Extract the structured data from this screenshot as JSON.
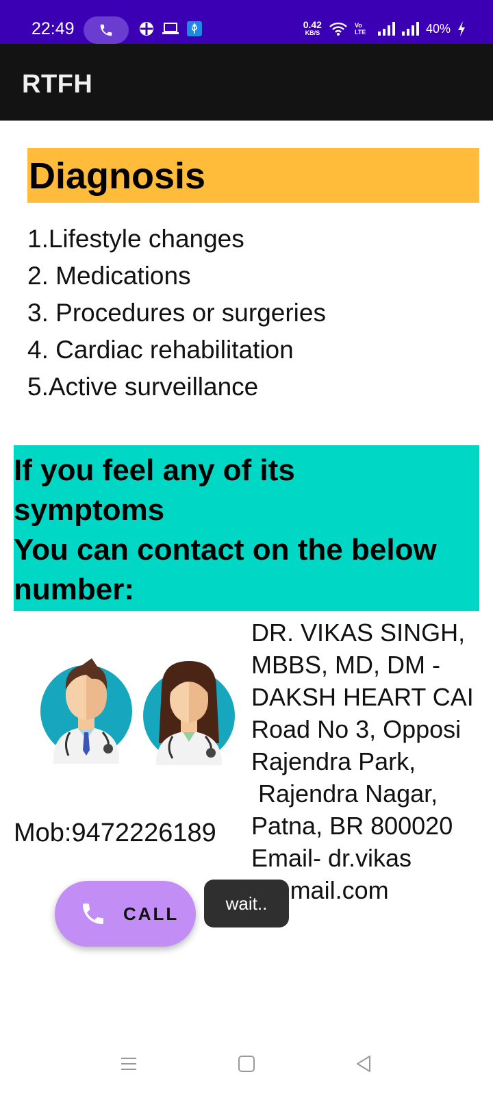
{
  "status_bar": {
    "time": "22:49",
    "net_speed_value": "0.42",
    "net_speed_unit": "KB/S",
    "volte": "Vo LTE",
    "battery": "40%",
    "colors": {
      "bar": "#3c00b4",
      "pill": "#6a3cd0"
    },
    "icons": [
      "phone-icon",
      "settings-grid-icon",
      "laptop-icon",
      "usb-icon",
      "wifi-icon",
      "signal-icon",
      "signal-icon",
      "charging-icon"
    ]
  },
  "app": {
    "title": "RTFH"
  },
  "diagnosis": {
    "heading": "Diagnosis",
    "items": [
      "1.Lifestyle changes",
      "2. Medications",
      "3. Procedures or surgeries",
      "4. Cardiac rehabilitation",
      "5.Active surveillance"
    ],
    "heading_color": "#ffbb3a"
  },
  "contact": {
    "line1": "If you feel any of its",
    "line2": "symptoms",
    "line3": "You can contact on the below",
    "line4": "number:",
    "color": "#00d7c4"
  },
  "doctor": {
    "mobile": "Mob:9472226189",
    "address_lines": [
      "DR. VIKAS SINGH,",
      "MBBS, MD, DM -",
      "DAKSH HEART CAI",
      "Road No 3, Opposi",
      "Rajendra Park,",
      " Rajendra Nagar,",
      "Patna, BR 800020",
      "Email- dr.vikas",
      "@gmail.com"
    ],
    "illustration": "doctors-illustration"
  },
  "call_button": {
    "label": "CALL",
    "icon": "phone-icon",
    "color": "#c28ef5"
  },
  "toast": {
    "text": "wait.."
  },
  "nav_bar": {
    "icons": [
      "menu-icon",
      "home-icon",
      "back-icon"
    ]
  }
}
